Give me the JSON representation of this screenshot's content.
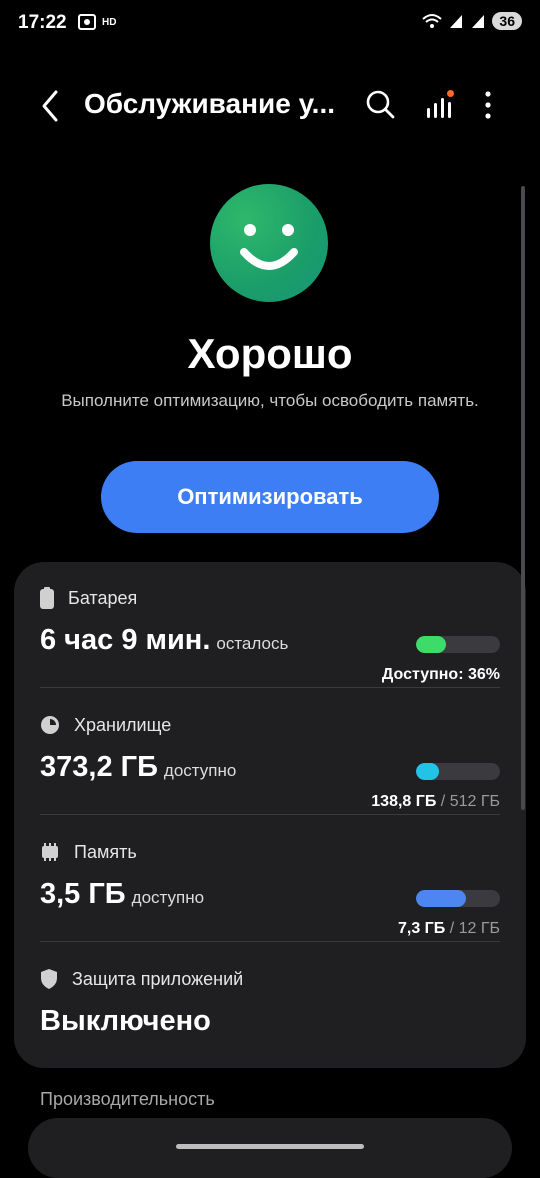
{
  "status_bar": {
    "time": "17:22",
    "hd": "HD",
    "battery_level": "36"
  },
  "app_bar": {
    "title": "Обслуживание у..."
  },
  "hero": {
    "status": "Хорошо",
    "subtitle": "Выполните оптимизацию, чтобы освободить память."
  },
  "optimize_button": {
    "label": "Оптимизировать"
  },
  "battery": {
    "label": "Батарея",
    "value": "6 час 9 мин.",
    "unit_text": "осталось",
    "detail": "Доступно: 36%",
    "level": 0.36,
    "color": "#3ddc6a"
  },
  "storage": {
    "label": "Хранилище",
    "value": "373,2 ГБ",
    "unit_text": "доступно",
    "used": "138,8 ГБ",
    "total": "/ 512 ГБ",
    "level": 0.27,
    "color": "#22c3e6"
  },
  "memory": {
    "label": "Память",
    "value": "3,5 ГБ",
    "unit_text": "доступно",
    "used": "7,3 ГБ",
    "total": "/ 12 ГБ",
    "level": 0.6,
    "color": "#4d86f0"
  },
  "app_protection": {
    "label": "Защита приложений",
    "value": "Выключено"
  },
  "performance": {
    "label": "Производительность"
  }
}
